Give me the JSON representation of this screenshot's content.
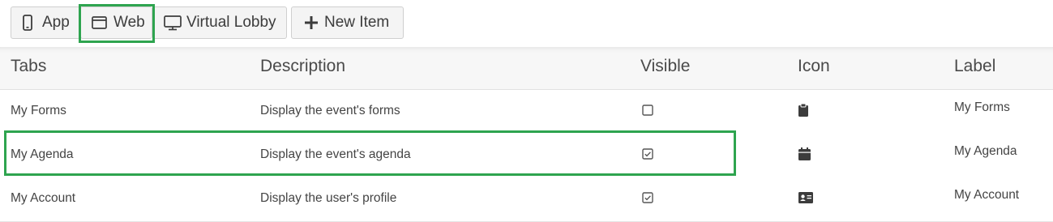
{
  "toolbar": {
    "buttons": [
      {
        "label": "App",
        "icon": "mobile-phone-icon"
      },
      {
        "label": "Web",
        "icon": "browser-window-icon"
      },
      {
        "label": "Virtual Lobby",
        "icon": "desktop-monitor-icon"
      },
      {
        "label": "New Item",
        "icon": "plus-icon"
      }
    ],
    "selected": "Web"
  },
  "table": {
    "columns": [
      "Tabs",
      "Description",
      "Visible",
      "Icon",
      "Label"
    ],
    "rows": [
      {
        "tab": "My Forms",
        "description": "Display the event's forms",
        "visible": false,
        "icon": "clipboard-icon",
        "label": "My Forms"
      },
      {
        "tab": "My Agenda",
        "description": "Display the event's agenda",
        "visible": true,
        "icon": "calendar-icon",
        "label": "My Agenda"
      },
      {
        "tab": "My Account",
        "description": "Display the user's profile",
        "visible": true,
        "icon": "id-card-icon",
        "label": "My Account"
      }
    ]
  },
  "colors": {
    "highlight": "#2ea44f",
    "button_bg": "#f4f4f4",
    "header_bg": "#f7f7f7"
  }
}
